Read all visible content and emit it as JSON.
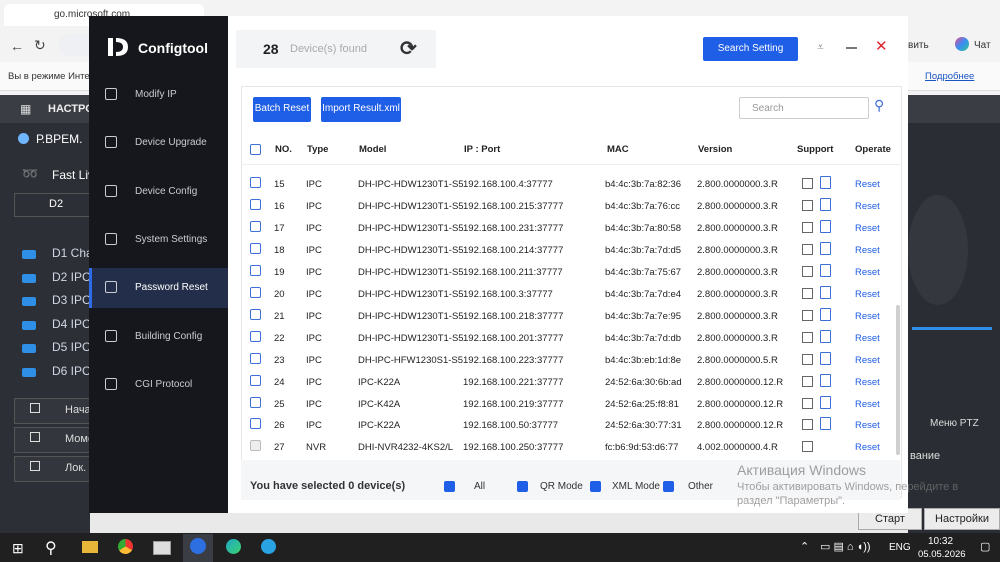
{
  "browser": {
    "tab_title": "go.microsoft.com",
    "infobar_text": "Вы в режиме Интерн",
    "infobar_link": "Подробнее",
    "side_text": "вить",
    "chat_label": "Чат"
  },
  "background_app": {
    "menu_label": "НАСТРО",
    "time_label": "Р.ВРЕМ.",
    "fast_label": "Fast Liv",
    "device_select": "D2",
    "channels": [
      "D1 Cha",
      "D2 IPC",
      "D3 IPC",
      "D4 IPC",
      "D5 IPC",
      "D6 IPC"
    ],
    "buttons": [
      "Нача",
      "Моме",
      "Лок."
    ],
    "right_menu": "Меню PTZ",
    "right_section": "вание",
    "start_button": "Старт",
    "settings_button": "Настройки"
  },
  "app": {
    "name": "Configtool",
    "device_count": "28",
    "device_found_label": "Device(s) found",
    "search_setting_label": "Search Setting"
  },
  "sidebar": {
    "items": [
      {
        "label": "Modify IP",
        "icon": "modify-ip-icon"
      },
      {
        "label": "Device Upgrade",
        "icon": "upgrade-icon"
      },
      {
        "label": "Device Config",
        "icon": "device-config-icon"
      },
      {
        "label": "System Settings",
        "icon": "system-settings-icon"
      },
      {
        "label": "Password Reset",
        "icon": "lock-icon",
        "active": true
      },
      {
        "label": "Building Config",
        "icon": "building-icon"
      },
      {
        "label": "CGI Protocol",
        "icon": "cgi-icon"
      }
    ]
  },
  "toolbar": {
    "batch_reset_label": "Batch Reset",
    "import_label": "Import Result.xml",
    "search_placeholder": "Search"
  },
  "table": {
    "headers": [
      "NO.",
      "Type",
      "Model",
      "IP : Port",
      "MAC",
      "Version",
      "Support",
      "Operate"
    ],
    "rows": [
      {
        "no": "15",
        "type": "IPC",
        "model": "DH-IPC-HDW1230T1-S5",
        "ip": "192.168.100.4:37777",
        "mac": "b4:4c:3b:7a:82:36",
        "version": "2.800.0000000.3.R",
        "op": "Reset",
        "xml": true
      },
      {
        "no": "16",
        "type": "IPC",
        "model": "DH-IPC-HDW1230T1-S5",
        "ip": "192.168.100.215:37777",
        "mac": "b4:4c:3b:7a:76:cc",
        "version": "2.800.0000000.3.R",
        "op": "Reset",
        "xml": true
      },
      {
        "no": "17",
        "type": "IPC",
        "model": "DH-IPC-HDW1230T1-S5",
        "ip": "192.168.100.231:37777",
        "mac": "b4:4c:3b:7a:80:58",
        "version": "2.800.0000000.3.R",
        "op": "Reset",
        "xml": true
      },
      {
        "no": "18",
        "type": "IPC",
        "model": "DH-IPC-HDW1230T1-S5",
        "ip": "192.168.100.214:37777",
        "mac": "b4:4c:3b:7a:7d:d5",
        "version": "2.800.0000000.3.R",
        "op": "Reset",
        "xml": true
      },
      {
        "no": "19",
        "type": "IPC",
        "model": "DH-IPC-HDW1230T1-S5",
        "ip": "192.168.100.211:37777",
        "mac": "b4:4c:3b:7a:75:67",
        "version": "2.800.0000000.3.R",
        "op": "Reset",
        "xml": true
      },
      {
        "no": "20",
        "type": "IPC",
        "model": "DH-IPC-HDW1230T1-S5",
        "ip": "192.168.100.3:37777",
        "mac": "b4:4c:3b:7a:7d:e4",
        "version": "2.800.0000000.3.R",
        "op": "Reset",
        "xml": true
      },
      {
        "no": "21",
        "type": "IPC",
        "model": "DH-IPC-HDW1230T1-S5",
        "ip": "192.168.100.218:37777",
        "mac": "b4:4c:3b:7a:7e:95",
        "version": "2.800.0000000.3.R",
        "op": "Reset",
        "xml": true
      },
      {
        "no": "22",
        "type": "IPC",
        "model": "DH-IPC-HDW1230T1-S5",
        "ip": "192.168.100.201:37777",
        "mac": "b4:4c:3b:7a:7d:db",
        "version": "2.800.0000000.3.R",
        "op": "Reset",
        "xml": true
      },
      {
        "no": "23",
        "type": "IPC",
        "model": "DH-IPC-HFW1230S1-S5",
        "ip": "192.168.100.223:37777",
        "mac": "b4:4c:3b:eb:1d:8e",
        "version": "2.800.0000000.5.R",
        "op": "Reset",
        "xml": true
      },
      {
        "no": "24",
        "type": "IPC",
        "model": "IPC-K22A",
        "ip": "192.168.100.221:37777",
        "mac": "24:52:6a:30:6b:ad",
        "version": "2.800.0000000.12.R",
        "op": "Reset",
        "xml": true
      },
      {
        "no": "25",
        "type": "IPC",
        "model": "IPC-K42A",
        "ip": "192.168.100.219:37777",
        "mac": "24:52:6a:25:f8:81",
        "version": "2.800.0000000.12.R",
        "op": "Reset",
        "xml": true
      },
      {
        "no": "26",
        "type": "IPC",
        "model": "IPC-K22A",
        "ip": "192.168.100.50:37777",
        "mac": "24:52:6a:30:77:31",
        "version": "2.800.0000000.12.R",
        "op": "Reset",
        "xml": true
      },
      {
        "no": "27",
        "type": "NVR",
        "model": "DHI-NVR4232-4KS2/L",
        "ip": "192.168.100.250:37777",
        "mac": "fc:b6:9d:53:d6:77",
        "version": "4.002.0000000.4.R",
        "op": "Reset",
        "xml": false,
        "disabled": true
      }
    ]
  },
  "footer": {
    "selected_prefix": "You have selected",
    "selected_count": "0",
    "selected_suffix": "device(s)",
    "filters": [
      "All",
      "QR Mode",
      "XML Mode",
      "Other"
    ]
  },
  "watermark": {
    "line1": "Активация Windows",
    "line2": "Чтобы активировать Windows, перейдите в",
    "line3": "раздел \"Параметры\"."
  },
  "taskbar": {
    "lang": "ENG",
    "time": "10:32",
    "date": "05.05.2026"
  }
}
